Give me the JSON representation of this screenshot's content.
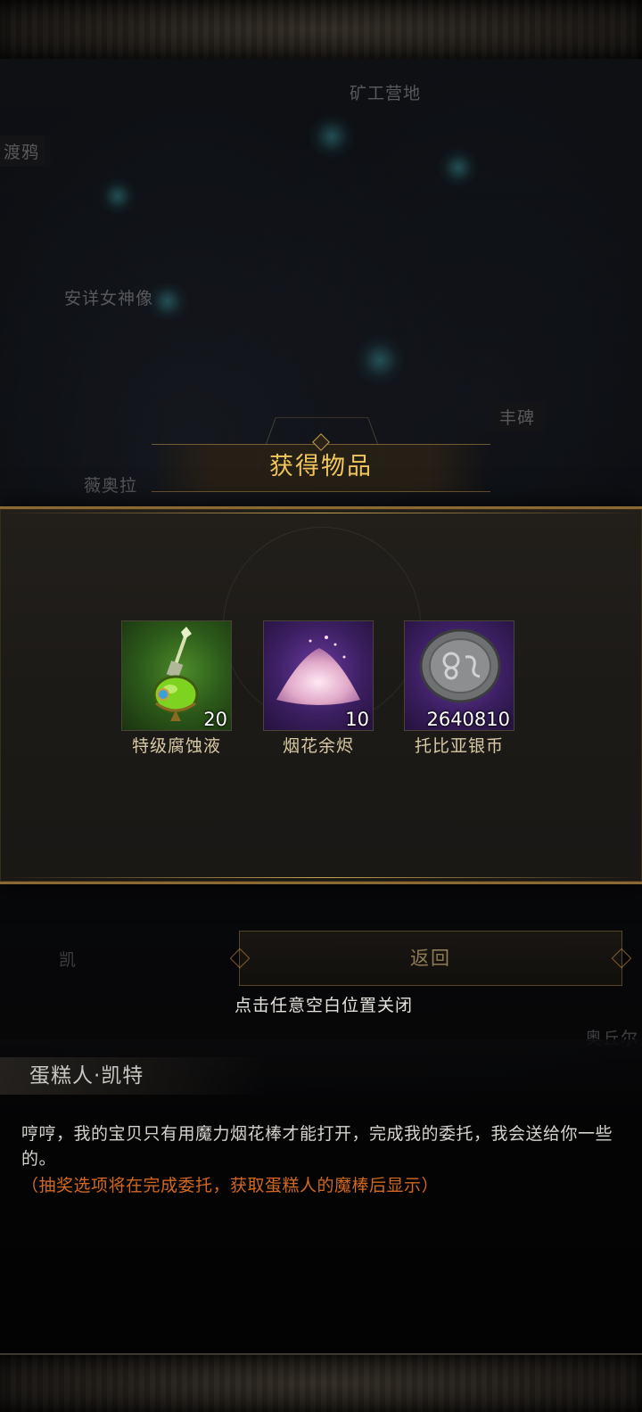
{
  "map": {
    "labels": {
      "miner_camp": "矿工营地",
      "raven": "渡鸦",
      "goddess_statue": "安详女神像",
      "stele": "丰碑",
      "viola": "薇奥拉"
    },
    "partial_labels": {
      "kai": "凯",
      "right_edge": "奥丘尔"
    }
  },
  "reward_popup": {
    "title": "获得物品",
    "items": [
      {
        "name": "特级腐蚀液",
        "count": "20",
        "rarity_color": "#3c7a22",
        "icon": "green-potion-icon"
      },
      {
        "name": "烟花余烬",
        "count": "10",
        "rarity_color": "#5a2e8a",
        "icon": "pink-ember-pile-icon"
      },
      {
        "name": "托比亚银币",
        "count": "2640810",
        "rarity_color": "#5a2e8a",
        "icon": "silver-coin-icon"
      }
    ],
    "close_hint": "点击任意空白位置关闭"
  },
  "back_button": {
    "label": "返回"
  },
  "dialog": {
    "speaker": "蛋糕人·凯特",
    "text": "哼哼，我的宝贝只有用魔力烟花棒才能打开，完成我的委托，我会送给你一些的。",
    "hint": "（抽奖选项将在完成委托，获取蛋糕人的魔棒后显示）"
  },
  "colors": {
    "title_gold": "#f1c75c",
    "hint_orange": "#d2691e",
    "frame_gold": "#8a6a32"
  }
}
